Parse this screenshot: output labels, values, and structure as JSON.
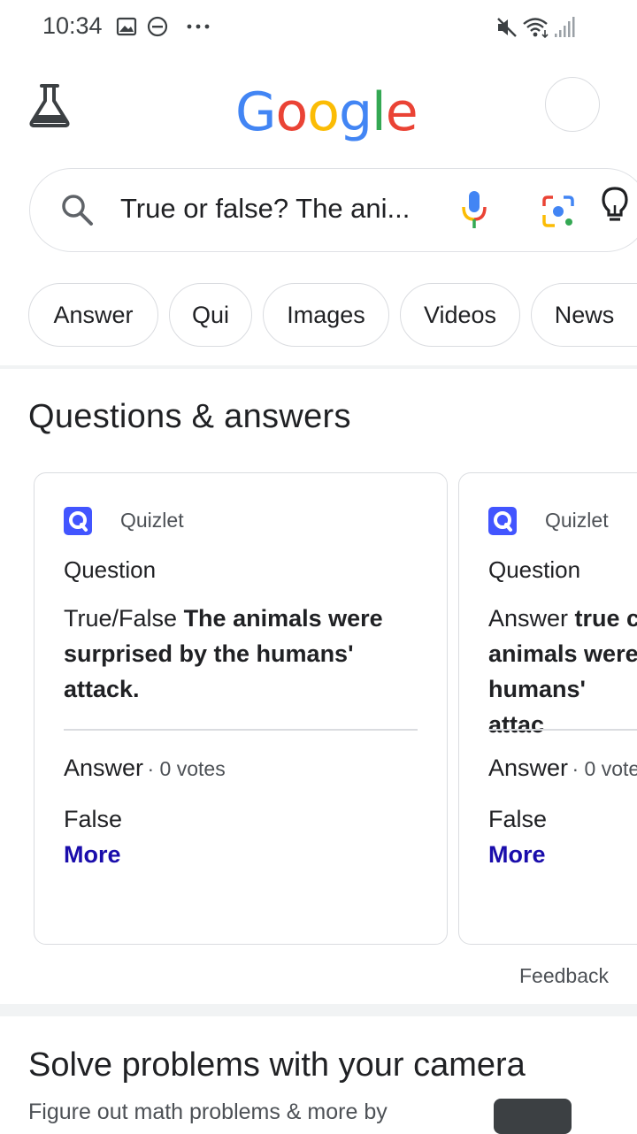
{
  "status_bar": {
    "time": "10:34",
    "left_icons": [
      "image-icon",
      "do-not-disturb-icon",
      "more-dots-icon"
    ],
    "right_icons": [
      "mute-icon",
      "wifi-icon",
      "signal-icon"
    ]
  },
  "header": {
    "logo": [
      "G",
      "o",
      "o",
      "g",
      "l",
      "e"
    ],
    "logo_colors": [
      "#4285F4",
      "#EA4335",
      "#FBBC05",
      "#4285F4",
      "#34A853",
      "#EA4335"
    ]
  },
  "search": {
    "query": "True or false? The ani..."
  },
  "chips": [
    "Answer",
    "Qui",
    "Images",
    "Videos",
    "News"
  ],
  "section": {
    "title": "Questions & answers"
  },
  "cards": [
    {
      "source": "Quizlet",
      "heading": "Question",
      "question_prefix": "True/False",
      "question_bold": "The animals were surprised by the humans' attack.",
      "answer_label": "Answer",
      "votes": "· 0 votes",
      "answer": "False",
      "more": "More"
    },
    {
      "source": "Quizlet",
      "heading": "Question",
      "question_prefix": "Answer",
      "question_bold": "true c animals were humans' attac",
      "answer_label": "Answer",
      "votes": "· 0 vote",
      "answer": "False",
      "more": "More"
    }
  ],
  "feedback": "Feedback",
  "next_section": {
    "title": "Solve problems with your camera",
    "subtitle": "Figure out math problems & more by"
  },
  "colors": {
    "link": "#1a0dab",
    "quizlet": "#4255ff"
  }
}
